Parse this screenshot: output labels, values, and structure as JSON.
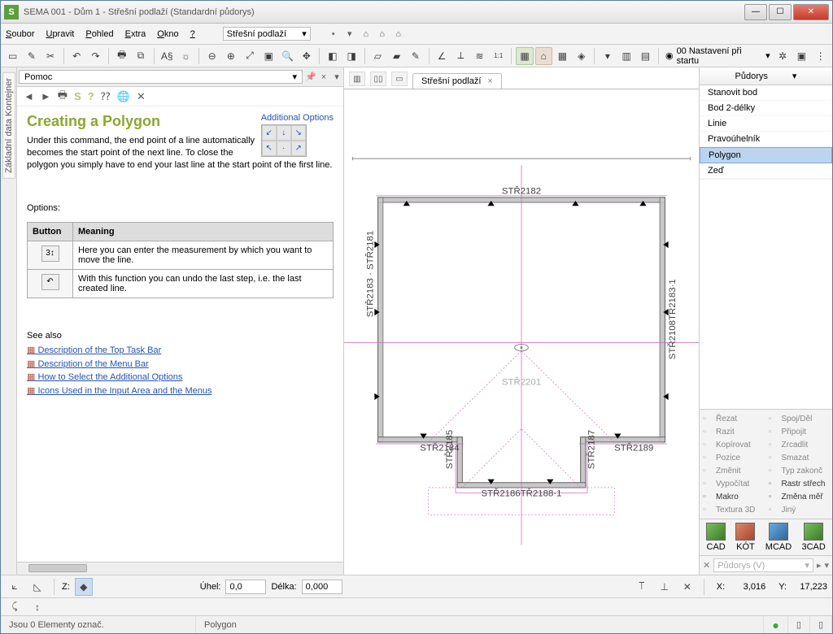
{
  "window": {
    "title": "SEMA  001 - Dům 1  - Střešní podlaží (Standardní půdorys)"
  },
  "menu": {
    "items": [
      "Soubor",
      "Upravit",
      "Pohled",
      "Extra",
      "Okno",
      "?"
    ],
    "combo": "Střešní podlaží"
  },
  "toolbar_preset": "00 Nastavení při startu",
  "help": {
    "combo": "Pomoc",
    "title": "Creating a Polygon",
    "addopt": "Additional Options",
    "intro": "Under this command, the end point of a line automatically becomes the start point of the next line. To close the polygon you simply have to end your last line at the start point of the first line.",
    "options_label": "Options:",
    "table": {
      "h1": "Button",
      "h2": "Meaning",
      "r1": "Here you can enter the measurement by which you want to move the line.",
      "r2": "With this function you can undo the last step, i.e. the last created line."
    },
    "seealso": {
      "label": "See also",
      "l1": "Description of the Top Task Bar",
      "l2": "Description of the Menu Bar",
      "l3": "How to Select the Additional Options",
      "l4": "Icons Used in the Input Area and the Menus"
    }
  },
  "tab": {
    "label": "Střešní podlaží"
  },
  "rightpanel": {
    "head": "Půdorys",
    "items": [
      "Stanovit bod",
      "Bod 2-délky",
      "Linie",
      "Pravoúhelník",
      "Polygon",
      "Zeď"
    ],
    "selected": "Polygon",
    "cmds": [
      [
        "Řezat",
        "Spoj/Děl",
        false
      ],
      [
        "Razit",
        "Připojit",
        false
      ],
      [
        "Kopírovat",
        "Zrcadlit",
        false
      ],
      [
        "Pozice",
        "Smazat",
        false
      ],
      [
        "Změnit",
        "Typ zakonč",
        false
      ],
      [
        "Vypočítat",
        "Rastr střech",
        true
      ],
      [
        "Makro",
        "Změna měř",
        true
      ],
      [
        "Textura 3D",
        "Jiný",
        false
      ]
    ],
    "bigs": [
      "CAD",
      "KÓT",
      "MCAD",
      "3CAD"
    ]
  },
  "canvas_labels": {
    "top": "STŘ2182",
    "leftv": "STŘ2183 · STŘ2181",
    "rightv": "STŘ2108TŘ2183·1",
    "bl": "STŘ2184",
    "br": "STŘ2189",
    "bbl": "STŘ2185",
    "bbr": "STŘ2187",
    "bot": "STŘ2186TŘ2188·1",
    "mid": "STŘ2201"
  },
  "bottom": {
    "z_label": "Z:",
    "angle_label": "Úhel:",
    "angle_val": "0,0",
    "length_label": "Délka:",
    "length_val": "0,000"
  },
  "coords": {
    "x_label": "X:",
    "x": "3,016",
    "y_label": "Y:",
    "y": "17,223"
  },
  "rpfooter": {
    "combo": "Půdorys  (V)"
  },
  "status": {
    "left": "Jsou 0 Elementy označ.",
    "mid": "Polygon"
  }
}
